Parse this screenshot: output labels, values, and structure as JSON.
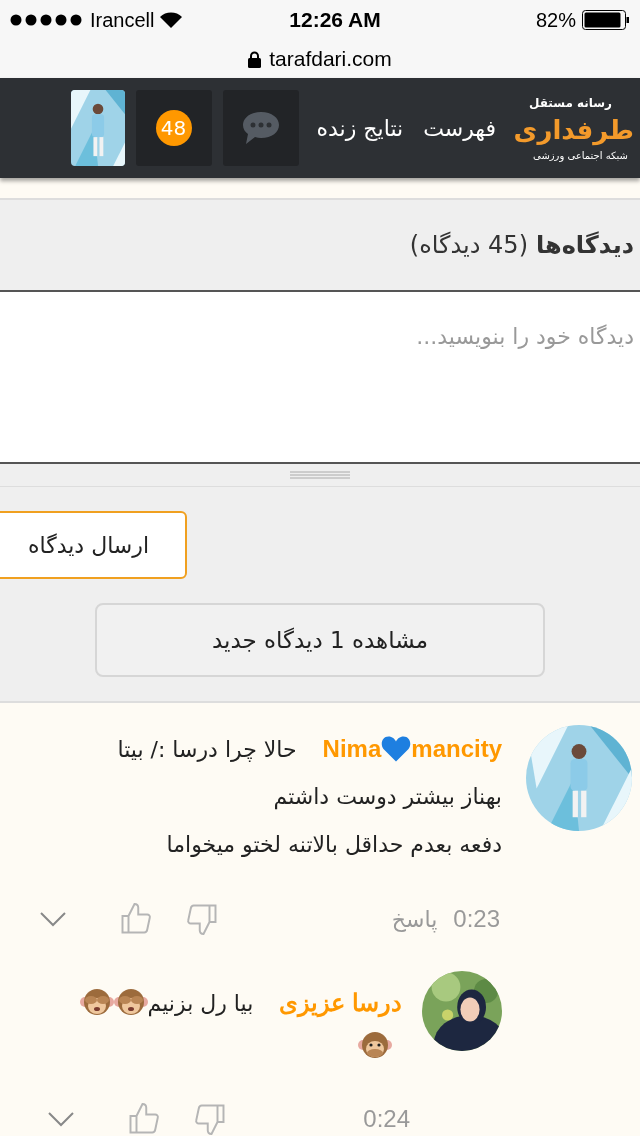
{
  "status_bar": {
    "carrier": "Irancell",
    "time": "12:26 AM",
    "battery": "82%"
  },
  "url_bar": {
    "url": "tarafdari.com"
  },
  "header": {
    "logo_tagline": "رسانه مستقل",
    "logo": "طرفداری",
    "logo_subtitle": "شبکه اجتماعی ورزشی",
    "nav": [
      "فهرست",
      "نتایج زنده"
    ],
    "notifications_badge": "48"
  },
  "comments_section": {
    "title": "دیدگاه‌ها",
    "count": "(45 دیدگاه)",
    "placeholder": "دیدگاه خود را بنویسید...",
    "submit": "ارسال دیدگاه",
    "new_comments": "مشاهده 1 دیدگاه جدید"
  },
  "comments": [
    {
      "author_parts": [
        "mancity",
        "Nima"
      ],
      "text_lines": [
        "حالا چرا درسا :/ بیتا",
        "بهناز بیشتر دوست داشتم",
        "دفعه بعدم حداقل بالاتنه لختو میخواما"
      ],
      "time": "0:23",
      "reply": "پاسخ"
    },
    {
      "author_parts": [
        "درسا عزیزی"
      ],
      "text_lines": [
        "بیا رل بزنیم"
      ],
      "time": "0:24"
    }
  ]
}
